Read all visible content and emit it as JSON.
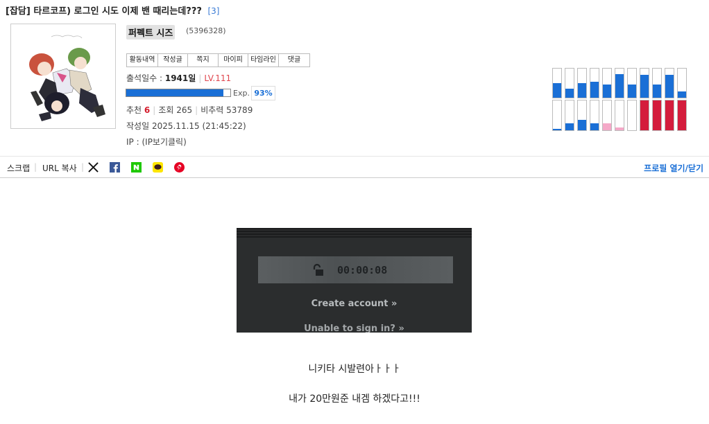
{
  "post": {
    "category": "[잡담]",
    "title": "타르코프) 로그인 시도 이제 밴 때리는데???",
    "comment_count": "[3]"
  },
  "author": {
    "nickname": "퍼펙트 시즈",
    "id": "(5396328)",
    "menu": [
      "활동내역",
      "작성글",
      "쪽지",
      "마이피",
      "타임라인",
      "댓글"
    ],
    "attendance_label": "출석일수 :",
    "attendance_value": "1941일",
    "level": "LV.111",
    "exp_label": "Exp.",
    "exp_percent": "93%",
    "exp_fraction": 0.93
  },
  "stats": {
    "recommend_label": "추천",
    "recommend_value": "6",
    "views_label": "조회",
    "views_value": "265",
    "ratio_label": "비추력",
    "ratio_value": "53789"
  },
  "meta": {
    "date_label": "작성일",
    "date_value": "2025.11.15 (21:45:22)",
    "ip_label": "IP :",
    "ip_value": "(IP보기클릭)"
  },
  "activity_bars": [
    {
      "top": 0.5,
      "bottom": 0.04,
      "bottom_color": "#1a6fd6"
    },
    {
      "top": 0.3,
      "bottom": 0.24,
      "bottom_color": "#1a6fd6"
    },
    {
      "top": 0.5,
      "bottom": 0.36,
      "bottom_color": "#1a6fd6"
    },
    {
      "top": 0.55,
      "bottom": 0.24,
      "bottom_color": "#1a6fd6"
    },
    {
      "top": 0.45,
      "bottom": 0.24,
      "bottom_color": "#f5a9c8"
    },
    {
      "top": 0.8,
      "bottom": 0.1,
      "bottom_color": "#f5a9c8"
    },
    {
      "top": 0.45,
      "bottom": 0.0,
      "bottom_color": "#1a6fd6"
    },
    {
      "top": 0.78,
      "bottom": 1.0,
      "bottom_color": "#d41c3c"
    },
    {
      "top": 0.45,
      "bottom": 1.0,
      "bottom_color": "#d41c3c"
    },
    {
      "top": 0.78,
      "bottom": 1.0,
      "bottom_color": "#d41c3c"
    },
    {
      "top": 0.22,
      "bottom": 1.0,
      "bottom_color": "#d41c3c"
    }
  ],
  "toolbar": {
    "scrap": "스크랩",
    "url_copy": "URL 복사",
    "profile_toggle": "프로필 열기/닫기",
    "share_icons": [
      "x-icon",
      "facebook-icon",
      "naver-icon",
      "kakaotalk-icon",
      "pinterest-icon"
    ]
  },
  "screenshot": {
    "timer": "00:00:08",
    "create_account": "Create account »",
    "unable_sign_in": "Unable to sign in? »"
  },
  "content": {
    "line1": "니키타 시발련아ㅏㅏㅏ",
    "line2": "내가 20만원준 내겜 하겠다고!!!"
  },
  "colors": {
    "accent_blue": "#1a6fd6",
    "level_red": "#e0464e",
    "recommend_red": "#d41c2c"
  }
}
